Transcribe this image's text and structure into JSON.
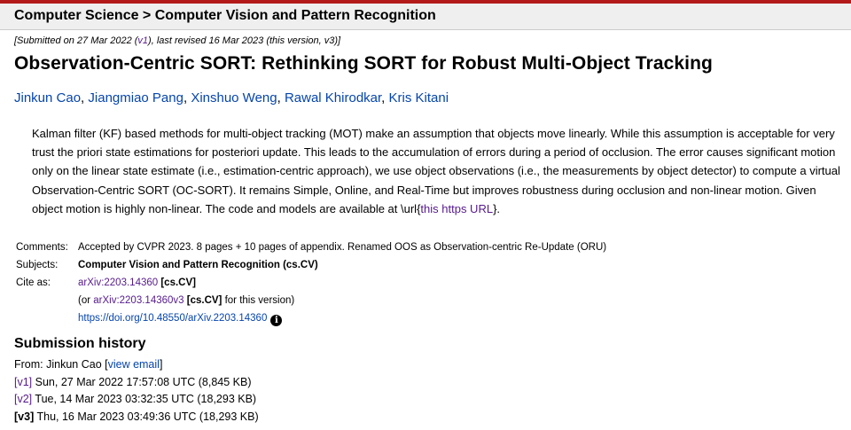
{
  "header": {
    "crumb_1": "Computer Science",
    "crumb_sep": " > ",
    "crumb_2": "Computer Vision and Pattern Recognition"
  },
  "dateline": {
    "prefix": "[Submitted on 27 Mar 2022 (",
    "v1_link": "v1",
    "suffix": "), last revised 16 Mar 2023 (this version, v3)]"
  },
  "title": "Observation-Centric SORT: Rethinking SORT for Robust Multi-Object Tracking",
  "authors": [
    "Jinkun Cao",
    "Jiangmiao Pang",
    "Xinshuo Weng",
    "Rawal Khirodkar",
    "Kris Kitani"
  ],
  "abstract": {
    "line1": "Kalman filter (KF) based methods for multi-object tracking (MOT) make an assumption that objects move linearly. While this assumption is acceptable for very",
    "line2": "trust the priori state estimations for posteriori update. This leads to the accumulation of errors during a period of occlusion. The error causes significant motion",
    "line3": "only on the linear state estimate (i.e., estimation-centric approach), we use object observations (i.e., the measurements by object detector) to compute a virtual",
    "line4": "Observation-Centric SORT (OC-SORT). It remains Simple, Online, and Real-Time but improves robustness during occlusion and non-linear motion. Given",
    "line5_prefix": "object motion is highly non-linear. The code and models are available at \\url{",
    "line5_link": "this https URL",
    "line5_suffix": "}."
  },
  "meta": {
    "comments_label": "Comments:",
    "comments_value": "Accepted by CVPR 2023. 8 pages + 10 pages of appendix. Renamed OOS as Observation-centric Re-Update (ORU)",
    "subjects_label": "Subjects:",
    "subjects_value": "Computer Vision and Pattern Recognition (cs.CV)",
    "cite_label": "Cite as:",
    "cite_link": "arXiv:2203.14360",
    "cite_tag": " [cs.CV]",
    "cite2_prefix": "(or ",
    "cite2_link": "arXiv:2203.14360v3",
    "cite2_tag": " [cs.CV]",
    "cite2_suffix": " for this version)",
    "doi_link": "https://doi.org/10.48550/arXiv.2203.14360",
    "info_icon": "i"
  },
  "history": {
    "title": "Submission history",
    "from_prefix": "From: Jinkun Cao [",
    "view_email": "view email",
    "from_suffix": "]",
    "versions": [
      {
        "tag": "[v1]",
        "text": " Sun, 27 Mar 2022 17:57:08 UTC (8,845 KB)"
      },
      {
        "tag": "[v2]",
        "text": " Tue, 14 Mar 2023 03:32:35 UTC (18,293 KB)"
      },
      {
        "tag": "[v3]",
        "text": " Thu, 16 Mar 2023 03:49:36 UTC (18,293 KB)"
      }
    ]
  },
  "colors": {
    "accent_red": "#b31b1b",
    "link_blue": "#0645ad",
    "link_visited": "#551a8b"
  }
}
